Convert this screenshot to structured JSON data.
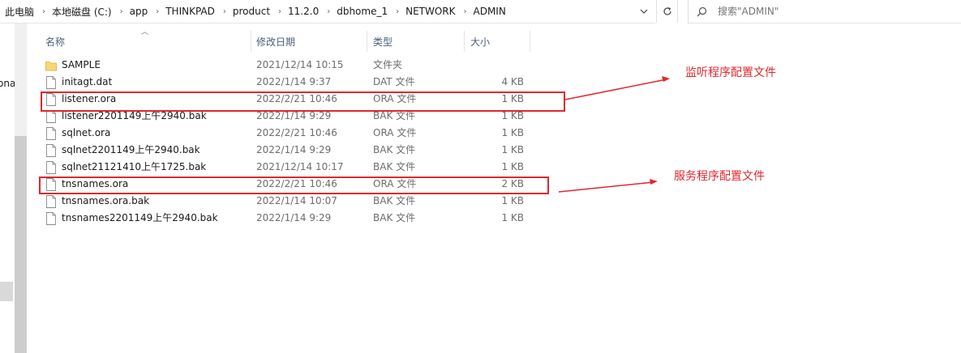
{
  "address_bar": {
    "crumbs": [
      "此电脑",
      "本地磁盘 (C:)",
      "app",
      "THINKPAD",
      "product",
      "11.2.0",
      "dbhome_1",
      "NETWORK",
      "ADMIN"
    ]
  },
  "search": {
    "placeholder": "搜索\"ADMIN\""
  },
  "nav": {
    "partial_text": "ona"
  },
  "columns": {
    "name": "名称",
    "date": "修改日期",
    "type": "类型",
    "size": "大小"
  },
  "files": [
    {
      "name": "SAMPLE",
      "date": "2021/12/14 10:15",
      "type": "文件夹",
      "size": "",
      "icon": "folder-icon"
    },
    {
      "name": "initagt.dat",
      "date": "2022/1/14 9:37",
      "type": "DAT 文件",
      "size": "4 KB",
      "icon": "file-icon"
    },
    {
      "name": "listener.ora",
      "date": "2022/2/21 10:46",
      "type": "ORA 文件",
      "size": "1 KB",
      "icon": "file-icon"
    },
    {
      "name": "listener2201149上午2940.bak",
      "date": "2022/1/14 9:29",
      "type": "BAK 文件",
      "size": "1 KB",
      "icon": "file-icon"
    },
    {
      "name": "sqlnet.ora",
      "date": "2022/2/21 10:46",
      "type": "ORA 文件",
      "size": "1 KB",
      "icon": "file-icon"
    },
    {
      "name": "sqlnet2201149上午2940.bak",
      "date": "2022/1/14 9:29",
      "type": "BAK 文件",
      "size": "1 KB",
      "icon": "file-icon"
    },
    {
      "name": "sqlnet21121410上午1725.bak",
      "date": "2021/12/14 10:17",
      "type": "BAK 文件",
      "size": "1 KB",
      "icon": "file-icon"
    },
    {
      "name": "tnsnames.ora",
      "date": "2022/2/21 10:46",
      "type": "ORA 文件",
      "size": "2 KB",
      "icon": "file-icon"
    },
    {
      "name": "tnsnames.ora.bak",
      "date": "2022/1/14 10:07",
      "type": "BAK 文件",
      "size": "1 KB",
      "icon": "file-icon"
    },
    {
      "name": "tnsnames2201149上午2940.bak",
      "date": "2022/1/14 9:29",
      "type": "BAK 文件",
      "size": "1 KB",
      "icon": "file-icon"
    }
  ],
  "annotations": {
    "listener_note": "监听程序配置文件",
    "service_note": "服务程序配置文件",
    "color": "#e0282e"
  },
  "colors": {
    "folder": "#f8d775",
    "header_text": "#4c607a"
  }
}
